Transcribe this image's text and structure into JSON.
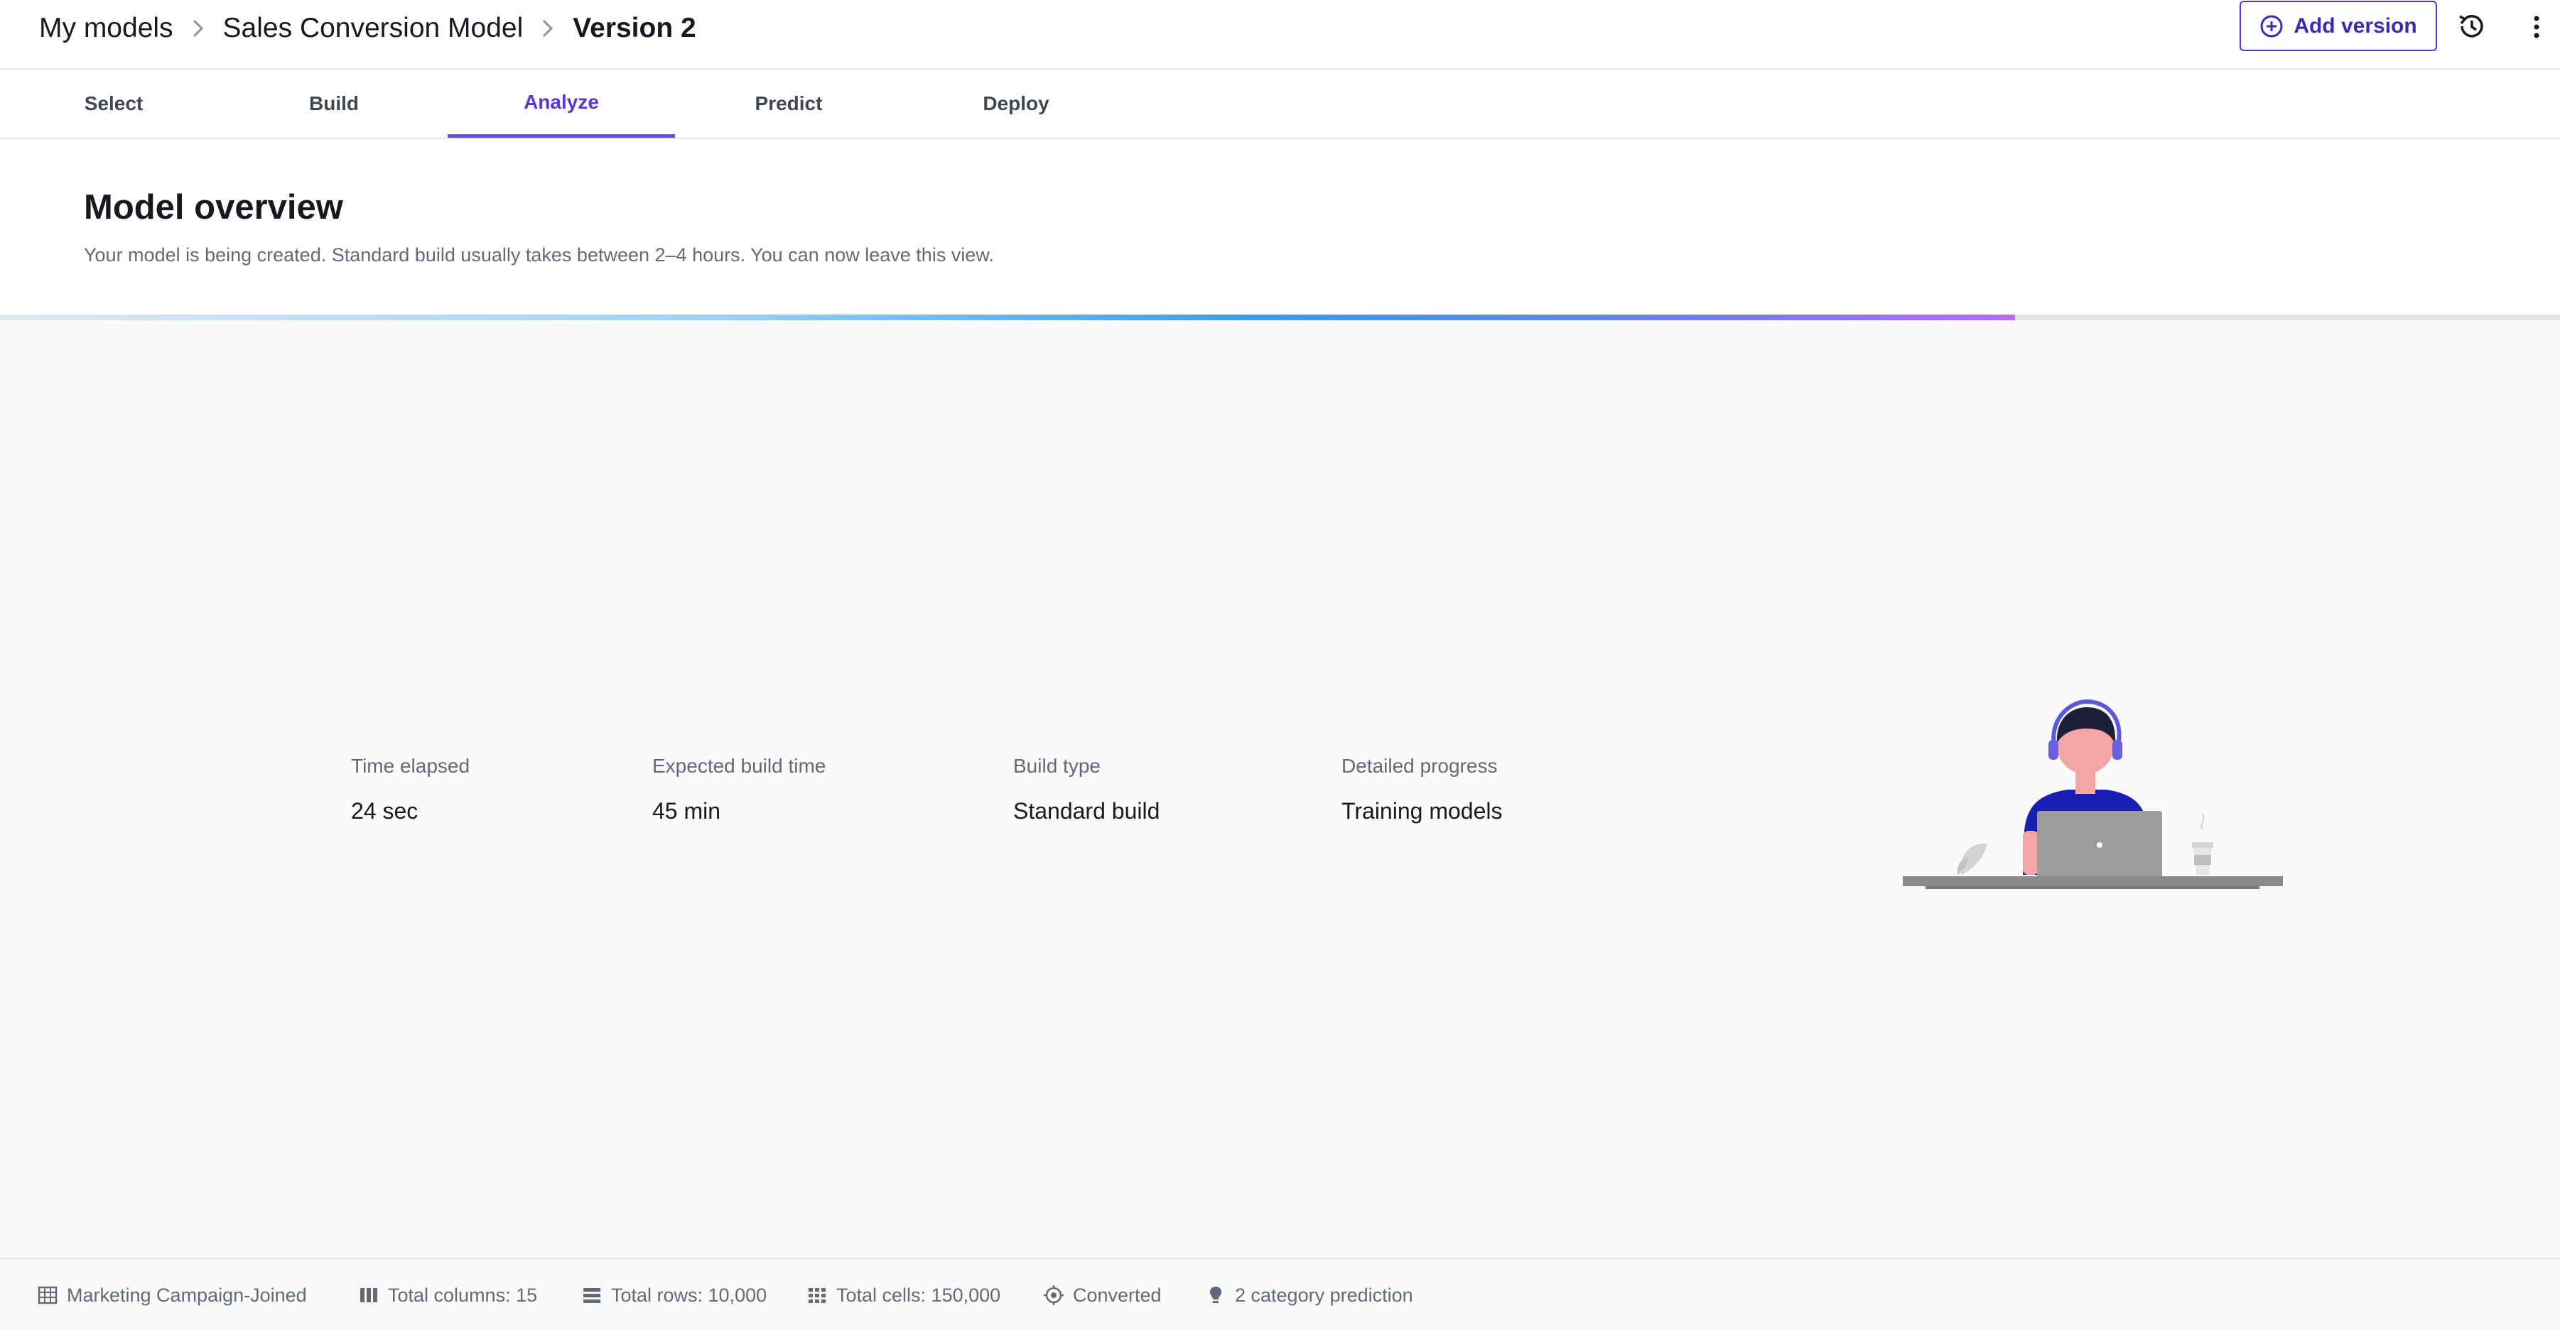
{
  "breadcrumb": {
    "items": [
      "My models",
      "Sales Conversion Model",
      "Version 2"
    ]
  },
  "header": {
    "add_version_label": "Add version"
  },
  "tabs": [
    {
      "label": "Select"
    },
    {
      "label": "Build"
    },
    {
      "label": "Analyze",
      "active": true
    },
    {
      "label": "Predict"
    },
    {
      "label": "Deploy"
    }
  ],
  "overview": {
    "title": "Model overview",
    "subtitle": "Your model is being created. Standard build usually takes between 2–4 hours. You can now leave this view.",
    "progress_fraction": 0.787
  },
  "stats": [
    {
      "label": "Time elapsed",
      "value": "24 sec"
    },
    {
      "label": "Expected build time",
      "value": "45 min"
    },
    {
      "label": "Build type",
      "value": "Standard build"
    },
    {
      "label": "Detailed progress",
      "value": "Training models"
    }
  ],
  "footer": [
    {
      "icon": "table-icon",
      "text": "Marketing Campaign-Joined"
    },
    {
      "icon": "columns-icon",
      "text": "Total columns: 15"
    },
    {
      "icon": "rows-icon",
      "text": "Total rows: 10,000"
    },
    {
      "icon": "cells-icon",
      "text": "Total cells: 150,000"
    },
    {
      "icon": "target-icon",
      "text": "Converted"
    },
    {
      "icon": "lightbulb-icon",
      "text": "2 category prediction"
    }
  ],
  "colors": {
    "accent": "#5b34d6",
    "text": "#16191f",
    "muted": "#5f6b7a"
  }
}
